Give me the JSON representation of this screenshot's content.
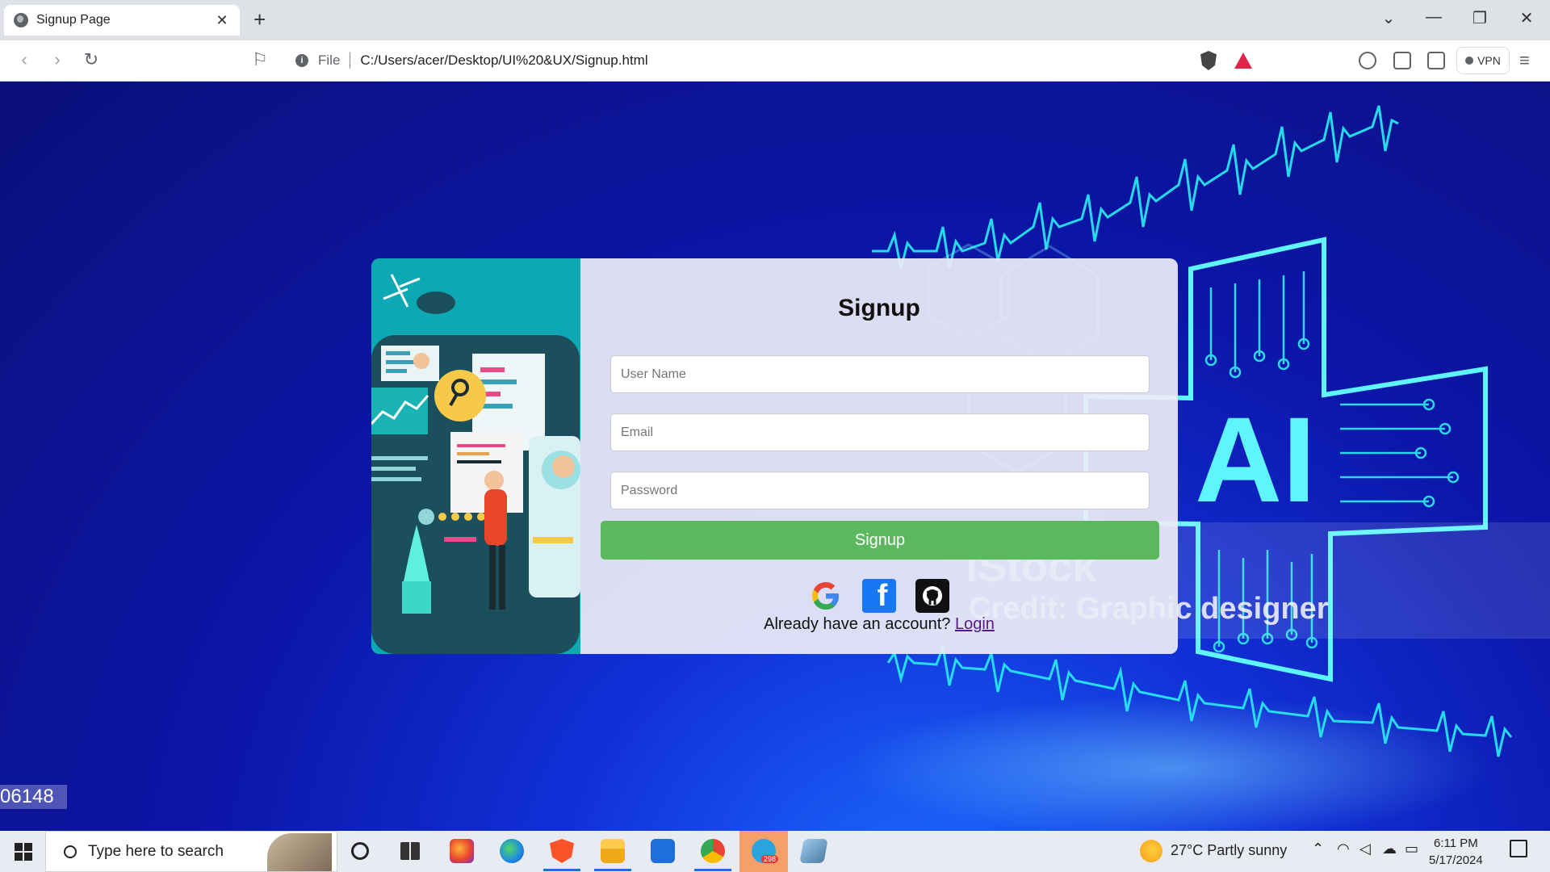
{
  "browser": {
    "tab_title": "Signup Page",
    "tab_close": "✕",
    "new_tab": "+",
    "url_scheme": "File",
    "url": "C:/Users/acer/Desktop/UI%20&UX/Signup.html",
    "vpn_label": "VPN"
  },
  "page": {
    "watermark": "iStock",
    "watermark_credit": "Credit: Graphic designer",
    "stock_id": "06148"
  },
  "signup": {
    "title": "Signup",
    "username_placeholder": "User Name",
    "email_placeholder": "Email",
    "password_placeholder": "Password",
    "submit_label": "Signup",
    "social": [
      "google-icon",
      "facebook-icon",
      "github-icon"
    ],
    "facebook_letter": "f",
    "account_prompt": "Already have an account?",
    "login_link": "Login",
    "submit_color": "#5cb85c"
  },
  "taskbar": {
    "search_placeholder": "Type here to search",
    "telegram_badge": "298",
    "weather": "27°C  Partly sunny",
    "time": "6:11 PM",
    "date": "5/17/2024"
  }
}
